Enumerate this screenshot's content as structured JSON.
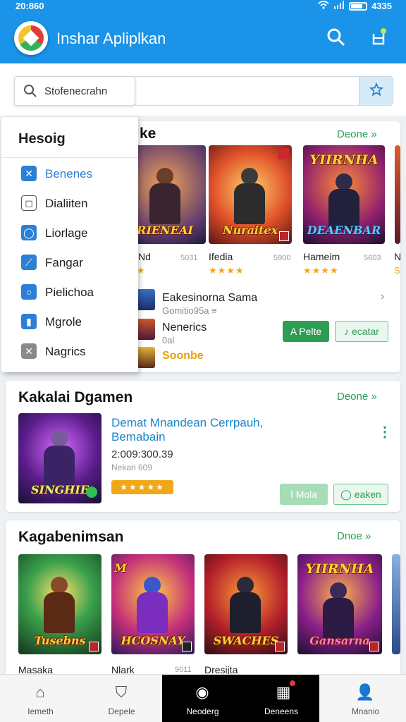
{
  "status_bar": {
    "time": "20:860",
    "battery": "4335"
  },
  "app_bar": {
    "title": "Inshar Apliplkan"
  },
  "search": {
    "placeholder": "Stofenecrahn"
  },
  "menu": {
    "header": "Hesoig",
    "items": [
      {
        "label": "Benenes",
        "icon": "tools-icon",
        "glyph": "✕",
        "active": true
      },
      {
        "label": "Dialiiten",
        "icon": "square-icon",
        "glyph": "◻",
        "active": false
      },
      {
        "label": "Liorlage",
        "icon": "circle-icon",
        "glyph": "◯",
        "active": false
      },
      {
        "label": "Fangar",
        "icon": "sword-icon",
        "glyph": "⟋",
        "active": false
      },
      {
        "label": "Pielichoa",
        "icon": "ring-icon",
        "glyph": "○",
        "active": false
      },
      {
        "label": "Mgrole",
        "icon": "chart-icon",
        "glyph": "▮",
        "active": false
      },
      {
        "label": "Nagrics",
        "icon": "cross-icon",
        "glyph": "✕",
        "active": false
      }
    ]
  },
  "section1": {
    "title_suffix": "ke",
    "more": "Deone »",
    "tiles": [
      {
        "top_word": "",
        "bottom_word": "RIENEAI",
        "name": "Nd",
        "size": "5031",
        "stars": "★"
      },
      {
        "top_word": "",
        "bottom_word": "Nuraitex",
        "name": "Ifedia",
        "size": "5900",
        "stars": "★★★★"
      },
      {
        "top_word": "YIIRNHA",
        "bottom_word": "DEAENBAR",
        "name": "Hameim",
        "size": "5603",
        "stars": "★★★★"
      },
      {
        "top_word": "",
        "bottom_word": "",
        "name": "Na",
        "size": "",
        "stars": "Se"
      }
    ],
    "list": [
      {
        "title": "Eakesinorna Sama",
        "sub": "Gomitio95a ≡"
      },
      {
        "title": "Nenerics",
        "sub": "0al"
      },
      {
        "title": "Soonbe",
        "sub": ""
      }
    ],
    "btn_primary": "A Pelte",
    "btn_secondary": "♪ ecatar"
  },
  "section2": {
    "title": "Kakalai Dgamen",
    "more": "Deone »",
    "tile_word": "SINGHIE",
    "app_title": "Demat Mnandean Cerrpauh, Bemabain",
    "meta": "2:009:300.39",
    "sub": "Nekari 609",
    "stars": "★★★★★",
    "btn_primary": "I Mola",
    "btn_secondary": "◯ eaken"
  },
  "section3": {
    "title": "Kagabenimsan",
    "more": "Dnoe »",
    "tiles": [
      {
        "top_word": "",
        "bottom_word": "Tusebns",
        "name": "Masaka"
      },
      {
        "top_word": "M",
        "bottom_word": "HCOSNAY",
        "name": "Nlark"
      },
      {
        "top_word": "",
        "bottom_word": "SWACHES",
        "name": "Dresijta"
      },
      {
        "top_word": "YIIRNHA",
        "bottom_word": "Gansarna",
        "name": ""
      }
    ],
    "size_2": "9011"
  },
  "bottom_nav": [
    {
      "label": "Iemeth",
      "icon": "home-icon",
      "glyph": "⌂"
    },
    {
      "label": "Depele",
      "icon": "shield-icon",
      "glyph": "⛉"
    },
    {
      "label": "Neoderg",
      "icon": "compass-icon",
      "glyph": "◉"
    },
    {
      "label": "Deneens",
      "icon": "grid-icon",
      "glyph": "▦"
    },
    {
      "label": "Mnanio",
      "icon": "person-icon",
      "glyph": "👤"
    }
  ],
  "colors": {
    "app_bar": "#1a93e8",
    "accent_green": "#2e9d54",
    "star": "#f0a818",
    "nav_active": "#000000"
  }
}
